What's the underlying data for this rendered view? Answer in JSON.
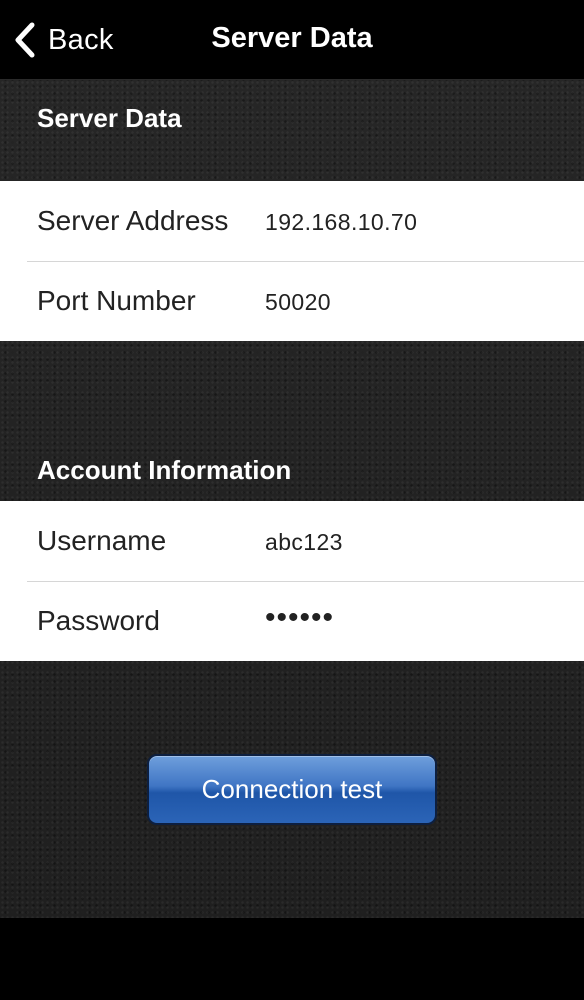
{
  "navbar": {
    "back_label": "Back",
    "title": "Server Data"
  },
  "server_section": {
    "header": "Server Data",
    "rows": [
      {
        "label": "Server Address",
        "value": "192.168.10.70"
      },
      {
        "label": "Port Number",
        "value": "50020"
      }
    ]
  },
  "account_section": {
    "header": "Account Information",
    "rows": [
      {
        "label": "Username",
        "value": "abc123"
      },
      {
        "label": "Password",
        "value": "••••••"
      }
    ]
  },
  "actions": {
    "connection_test_label": "Connection test"
  },
  "colors": {
    "navbar_bg": "#000000",
    "content_bg": "#222222",
    "button_blue": "#2b64b7",
    "text_dark": "#222222"
  },
  "icons": {
    "back": "chevron-left-icon"
  }
}
